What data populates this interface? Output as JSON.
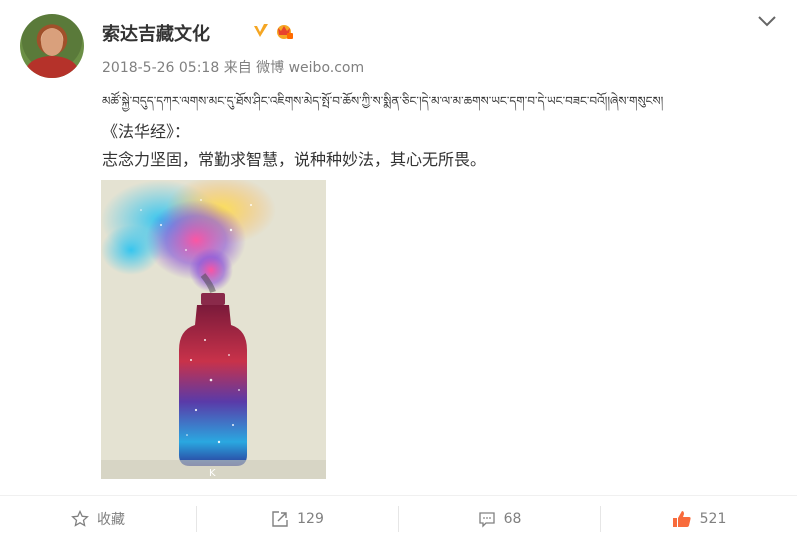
{
  "post": {
    "username": "索达吉藏文化",
    "meta": "2018-5-26 05:18 来自 微博 weibo.com",
    "tibetan_line": "མཚོ་སྐྱེ་བདུད་དཀར་ལགས་མང་དུ་ཐོས་ཤིང་འཇིགས་མེད་སྤོ་བ་ཆོས་ཀྱི་ས་སྨིན་ཅིང་།དེ་མ་ལ་མ་ཆགས་ཡང་དག་བ་དེ་ཡང་བཟང་བའོ།།ཞེས་གསུངས།",
    "text_line1": "《法华经》：",
    "text_line2": "志念力坚固，常勤求智慧，说种种妙法，其心无所畏。",
    "image_description": "galaxy-bottle-photo",
    "watermark": "K"
  },
  "actions": {
    "favorite_label": "收藏",
    "repost_count": "129",
    "comment_count": "68",
    "like_count": "521"
  },
  "colors": {
    "verified_badge": "#f5a623",
    "like_icon": "#f86b3c",
    "meta_gray": "#808080"
  }
}
